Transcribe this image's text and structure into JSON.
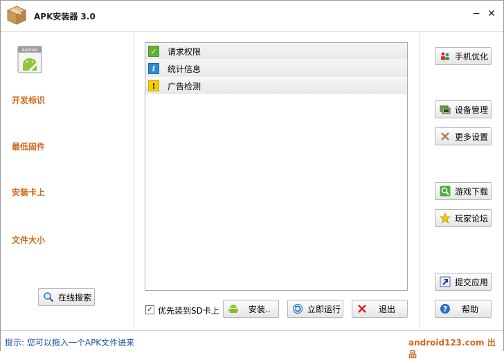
{
  "window": {
    "title": "APK安装器 3.0",
    "minimize_glyph": "−",
    "close_glyph": "✕"
  },
  "left_panel": {
    "labels": [
      "开发标识",
      "最低固件",
      "安装卡上",
      "文件大小"
    ],
    "android_badge_text": "Android",
    "search_button": "在线搜索"
  },
  "list": {
    "items": [
      {
        "icon": "check-icon",
        "label": "请求权限"
      },
      {
        "icon": "info-icon",
        "label": "统计信息"
      },
      {
        "icon": "warning-icon",
        "label": "广告检测"
      }
    ]
  },
  "bottom_bar": {
    "sd_checkbox_label": "优先装到SD卡上",
    "sd_checked": true,
    "install_button": "安装..",
    "run_button": "立即运行",
    "exit_button": "退出"
  },
  "right_panel": {
    "buttons": [
      "手机优化",
      "设备管理",
      "更多设置",
      "游戏下载",
      "玩家论坛",
      "提交应用",
      "帮助"
    ]
  },
  "status": {
    "hint": "提示: 您可以拖入一个APK文件进来",
    "brand": "android123.com 出品"
  },
  "colors": {
    "accent_orange": "#d2691e",
    "hint_blue": "#1f4fa8",
    "check_green": "#66b032",
    "info_blue": "#2d8ad6",
    "warn_yellow": "#f4d000"
  }
}
